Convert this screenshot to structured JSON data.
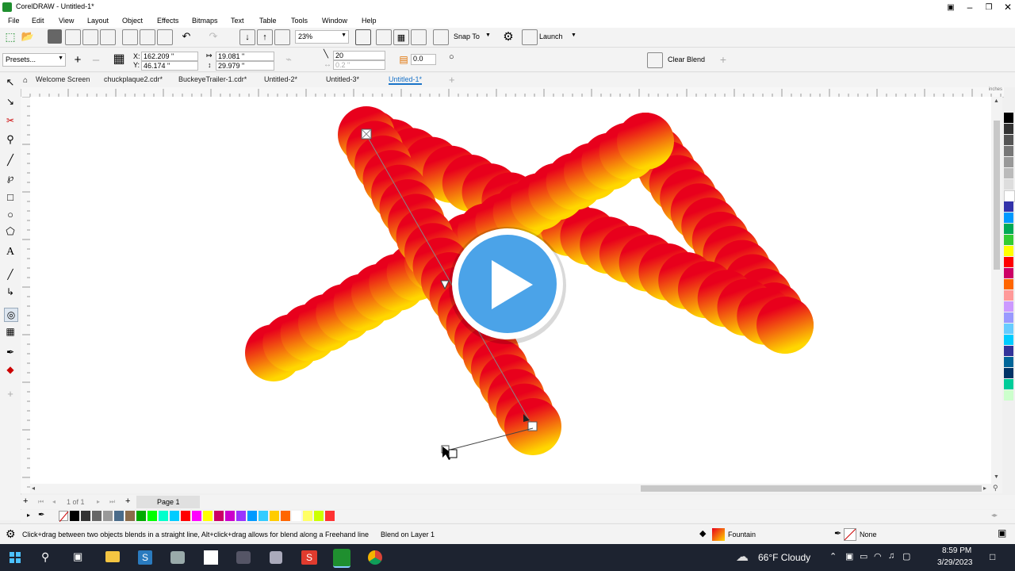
{
  "app": {
    "title": "CorelDRAW - Untitled-1*",
    "accent": "#3b9c3b"
  },
  "menu": [
    "File",
    "Edit",
    "View",
    "Layout",
    "Object",
    "Effects",
    "Bitmaps",
    "Text",
    "Table",
    "Tools",
    "Window",
    "Help"
  ],
  "toolbar1": {
    "zoom": "23%",
    "snap_label": "Snap To",
    "launch_label": "Launch"
  },
  "toolbar2": {
    "presets_label": "Presets...",
    "x_value": "162.209 \"",
    "y_value": "46.174 \"",
    "x_prefix": "X:",
    "y_prefix": "Y:",
    "w_value": "19.081 \"",
    "h_value": "29.979 \"",
    "steps_value": "20",
    "spacing_value": "0.2 \"",
    "angle_value": "0.0",
    "clear_blend_label": "Clear Blend"
  },
  "tabs": [
    {
      "label": "Welcome Screen",
      "active": false
    },
    {
      "label": "chuckplaque2.cdr*",
      "active": false
    },
    {
      "label": "BuckeyeTrailer-1.cdr*",
      "active": false
    },
    {
      "label": "Untitled-2*",
      "active": false
    },
    {
      "label": "Untitled-3*",
      "active": false
    },
    {
      "label": "Untitled-1*",
      "active": true
    }
  ],
  "ruler_units": "inches",
  "pagebar": {
    "page_count": "1 of 1",
    "page_tab": "Page 1"
  },
  "bottom_palette": [
    "#000000",
    "#333333",
    "#666666",
    "#999999",
    "#4a6b8a",
    "#8b6b4a",
    "#00aa00",
    "#00ff00",
    "#00ffcc",
    "#00ccff",
    "#ff0000",
    "#ff00ff",
    "#ffff00",
    "#cc0066",
    "#cc00cc",
    "#9933ff",
    "#0099ff",
    "#33ccff",
    "#ffcc00",
    "#ff6600",
    "#ffffff",
    "#ffff66",
    "#ccff00",
    "#ff3333"
  ],
  "right_palette": [
    "#000000",
    "#333333",
    "#555555",
    "#777777",
    "#999999",
    "#bbbbbb",
    "#dddddd",
    "#ffffff",
    "#3333aa",
    "#0099ff",
    "#00aa55",
    "#33cc33",
    "#ffff00",
    "#ff0000",
    "#cc0066",
    "#ff6600",
    "#ff9999",
    "#cc99ff",
    "#9999ff",
    "#66ccff",
    "#00ccff",
    "#333399",
    "#006699",
    "#003366",
    "#00cc99",
    "#ccffcc"
  ],
  "status": {
    "hint": "Click+drag between two objects blends in a straight line, Alt+click+drag allows for blend along a Freehand line",
    "layer": "Blend on Layer 1",
    "fill_label": "Fountain",
    "outline_label": "None"
  },
  "taskbar": {
    "weather": "66°F  Cloudy",
    "time": "8:59 PM",
    "date": "3/29/2023"
  },
  "blend_colors": {
    "start": "#e8001c",
    "end": "#ffd700"
  }
}
